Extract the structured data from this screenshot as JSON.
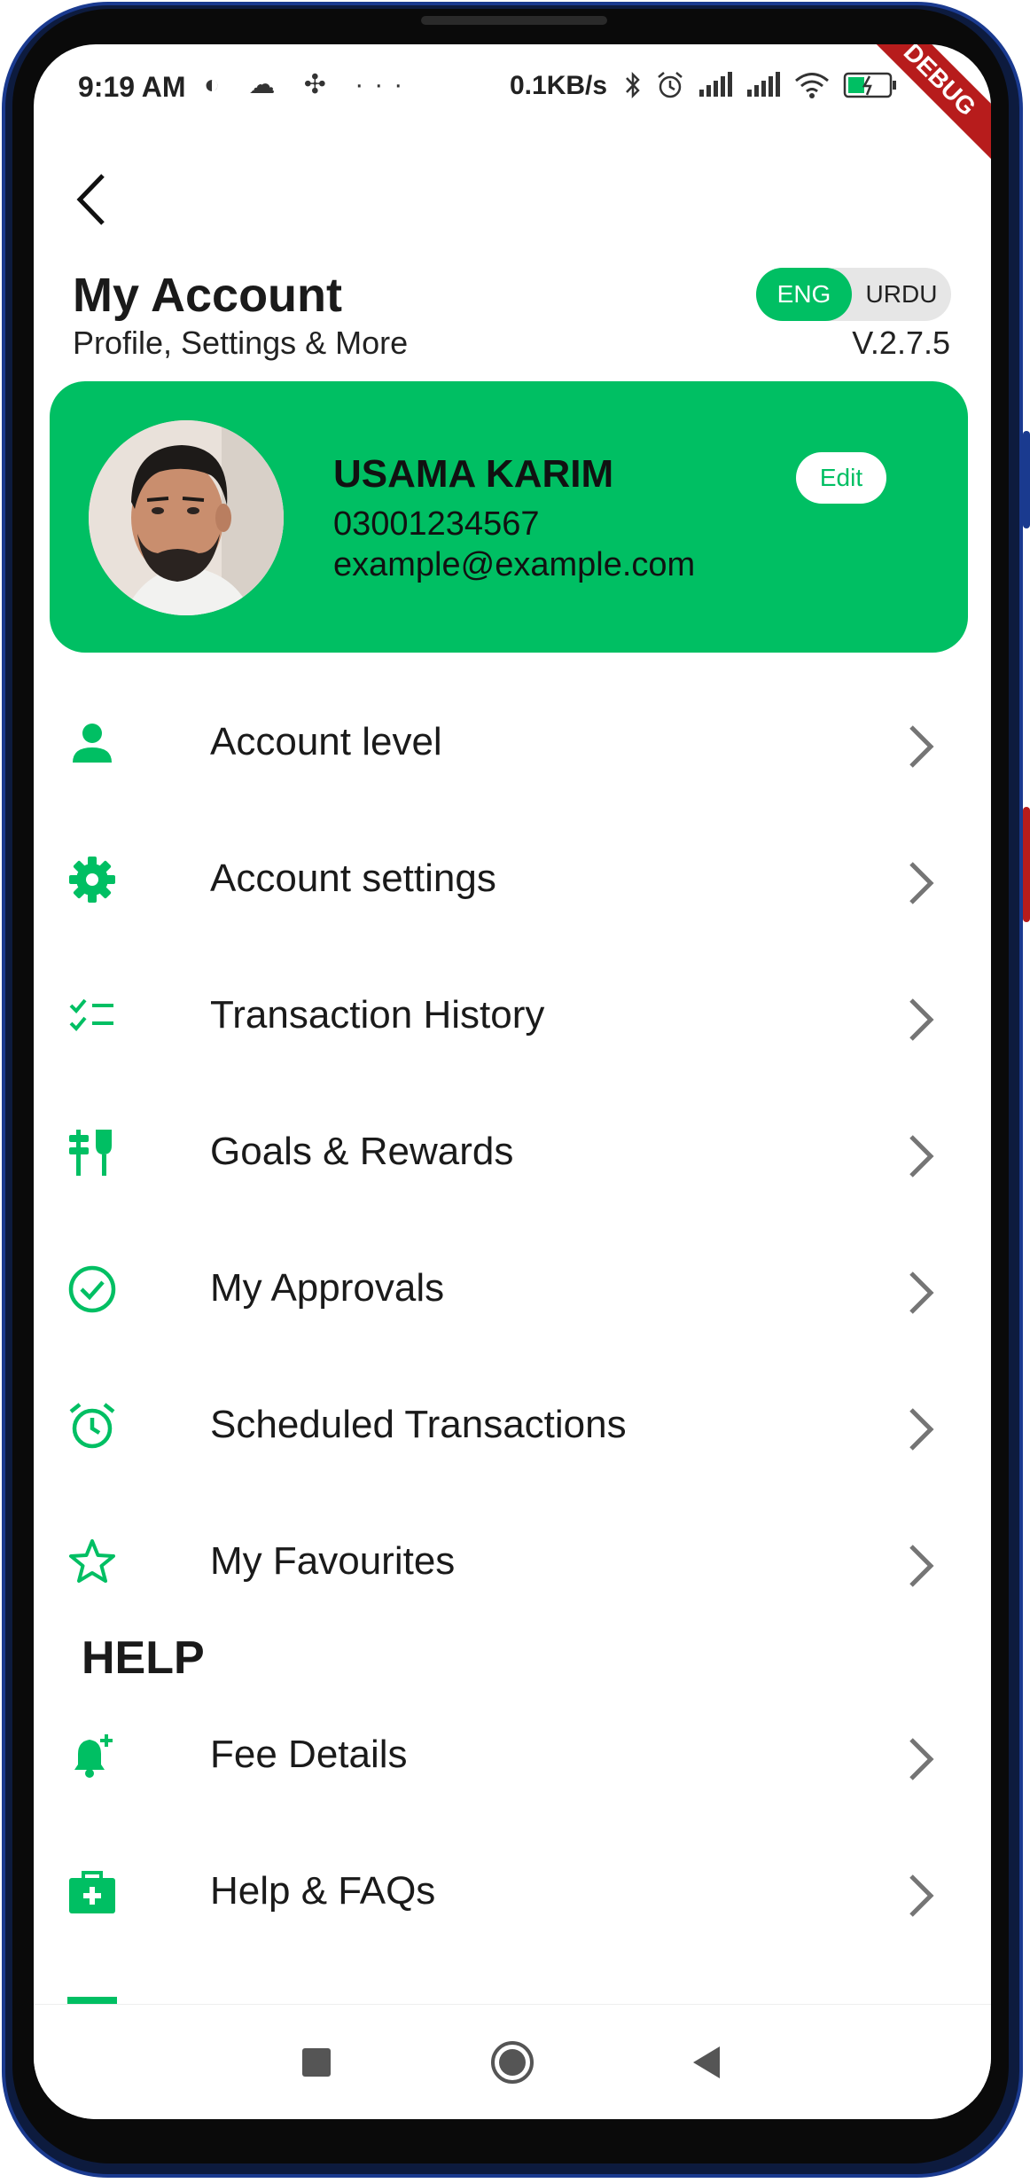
{
  "status_bar": {
    "time": "9:19 AM",
    "left_icons": "◐ ☁ ✣ ···",
    "net_speed": "0.1KB/s",
    "debug_banner": "DEBUG"
  },
  "header": {
    "title": "My Account",
    "subtitle": "Profile, Settings & More",
    "language_toggle": {
      "active": "ENG",
      "inactive": "URDU"
    },
    "version": "V.2.7.5"
  },
  "profile": {
    "name": "USAMA KARIM",
    "phone": "03001234567",
    "email": "example@example.com",
    "edit_label": "Edit"
  },
  "menu": [
    {
      "label": "Account level",
      "icon": "person-icon"
    },
    {
      "label": "Account settings",
      "icon": "gear-icon"
    },
    {
      "label": "Transaction History",
      "icon": "checklist-icon"
    },
    {
      "label": "Goals & Rewards",
      "icon": "goals-icon"
    },
    {
      "label": "My Approvals",
      "icon": "check-circle-icon"
    },
    {
      "label": "Scheduled Transactions",
      "icon": "alarm-icon"
    },
    {
      "label": "My Favourites",
      "icon": "star-icon"
    }
  ],
  "help_section": {
    "title": "HELP",
    "items": [
      {
        "label": "Fee Details",
        "icon": "bell-plus-icon"
      },
      {
        "label": "Help & FAQs",
        "icon": "medkit-icon"
      }
    ]
  },
  "colors": {
    "accent": "#00bf63",
    "text": "#1a1a1a",
    "chevron": "#757575"
  }
}
